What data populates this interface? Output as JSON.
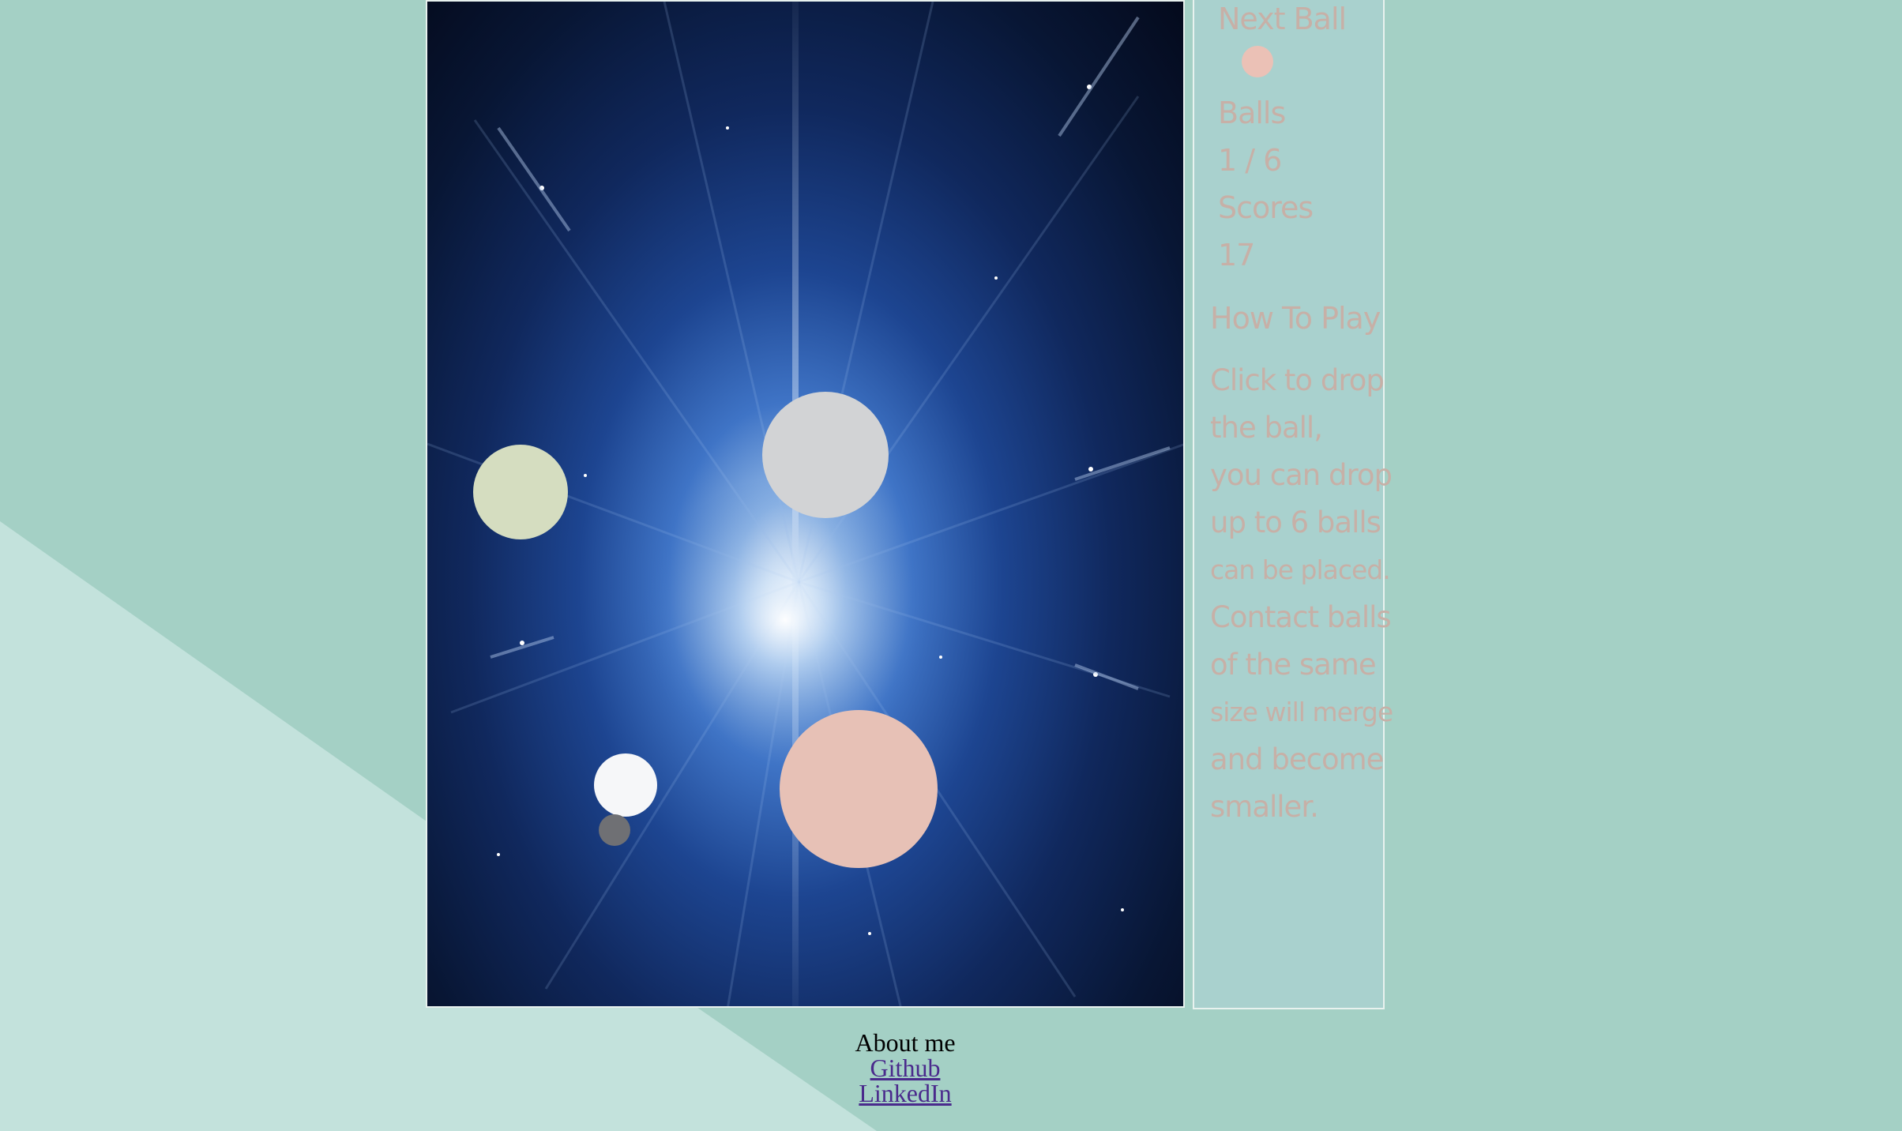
{
  "game": {
    "balls": [
      {
        "kind": "sage",
        "color": "#d5ddc0"
      },
      {
        "kind": "grey",
        "color": "#d2d3d5"
      },
      {
        "kind": "white",
        "color": "#f6f7f9"
      },
      {
        "kind": "dark-grey",
        "color": "#6f7074"
      },
      {
        "kind": "peach",
        "color": "#e7c1b6"
      }
    ]
  },
  "panel": {
    "next_ball_label": "Next Ball",
    "next_ball_color": "#ebc1b6",
    "balls_label": "Balls",
    "balls_count": "1 / 6",
    "scores_label": "Scores",
    "scores_value": "17",
    "howto_title": "How To Play",
    "howto_lines": [
      "Click to drop",
      "the ball,",
      "you can drop",
      "up to 6 balls",
      "can be placed.",
      "Contact balls",
      "of the same",
      "size will merge",
      "and become",
      "smaller."
    ]
  },
  "footer": {
    "about_label": "About me",
    "github_label": "Github",
    "linkedin_label": "LinkedIn"
  },
  "colors": {
    "page_background": "#a4d0c5",
    "page_light_band": "#c3e2dc",
    "panel_background": "#a9d1ce",
    "panel_text": "#c7b0a7",
    "link": "#4a2a8c"
  }
}
